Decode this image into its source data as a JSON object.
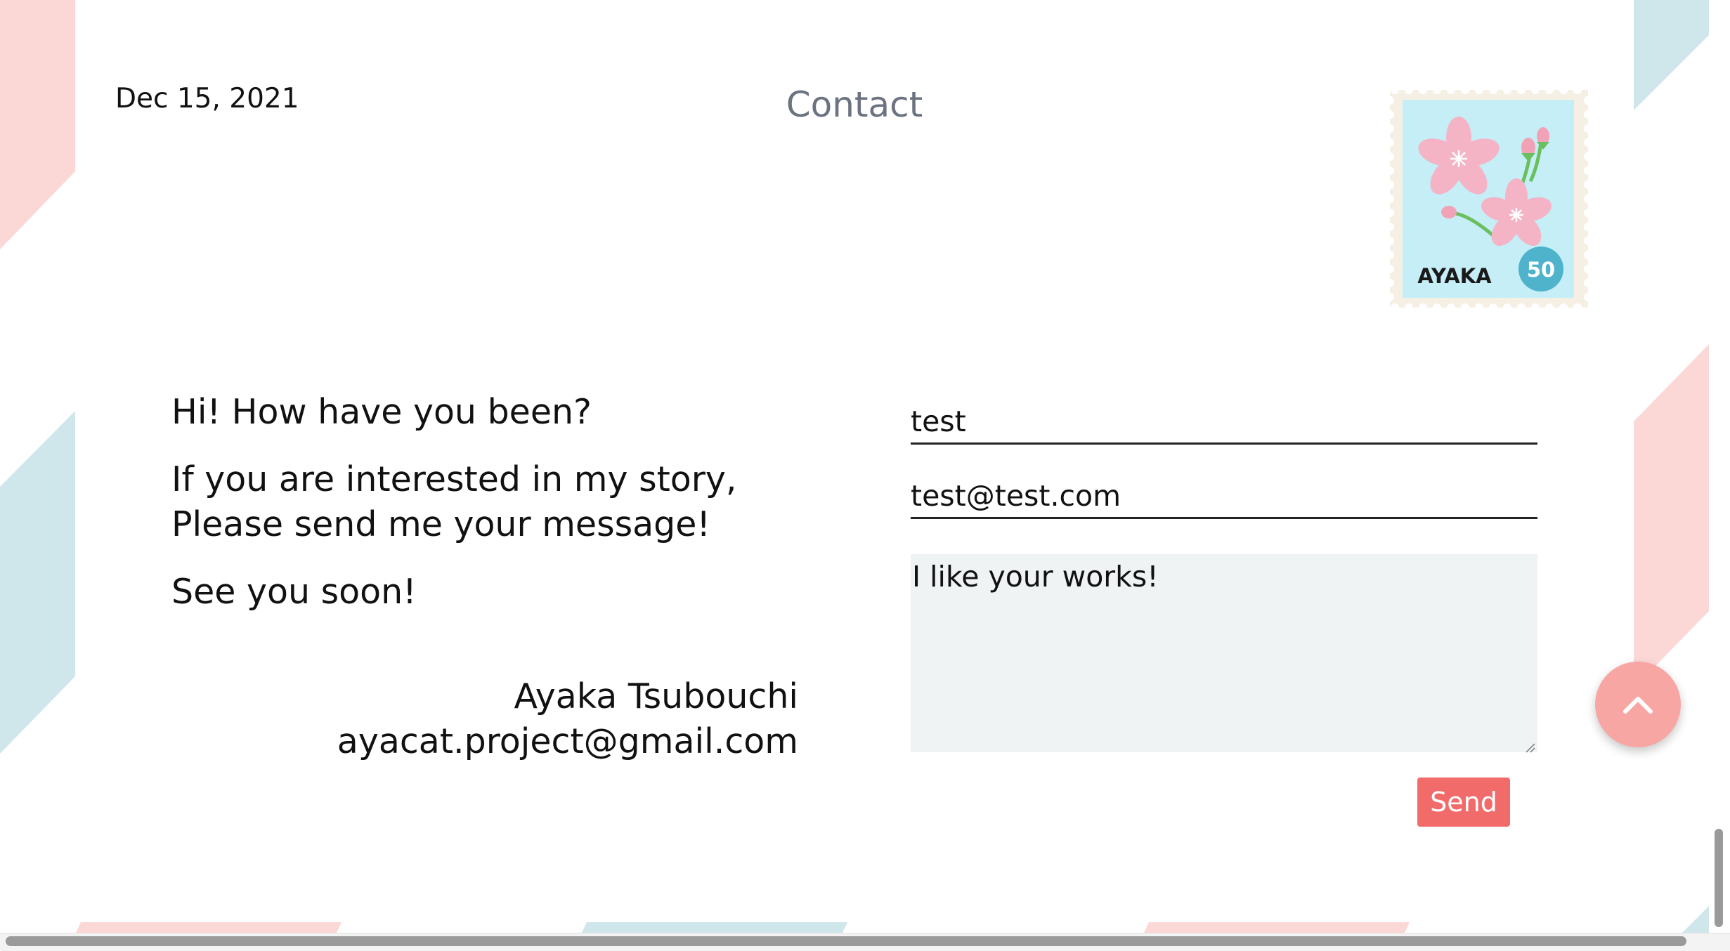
{
  "letter": {
    "date": "Dec 15, 2021",
    "title": "Contact"
  },
  "stamp": {
    "name": "AYAKA",
    "value": "50",
    "icon": "cherry-blossom-stamp"
  },
  "message": {
    "lines": [
      "Hi! How have you been?",
      "If you are interested in my story, Please send me your message!",
      "See you soon!"
    ],
    "signature_name": "Ayaka Tsubouchi",
    "signature_email": "ayacat.project@gmail.com"
  },
  "form": {
    "name_value": "test",
    "email_value": "test@test.com",
    "message_value": "I like your works!",
    "send_label": "Send"
  },
  "colors": {
    "stripe_pink": "#fbd8d6",
    "stripe_blue": "#cfe6eb",
    "accent": "#f26b6b",
    "scroll_top": "#f8a6a4",
    "title_gray": "#6b7280",
    "textarea_bg": "#eff3f3"
  },
  "icons": {
    "scroll_top": "chevron-up-icon"
  }
}
